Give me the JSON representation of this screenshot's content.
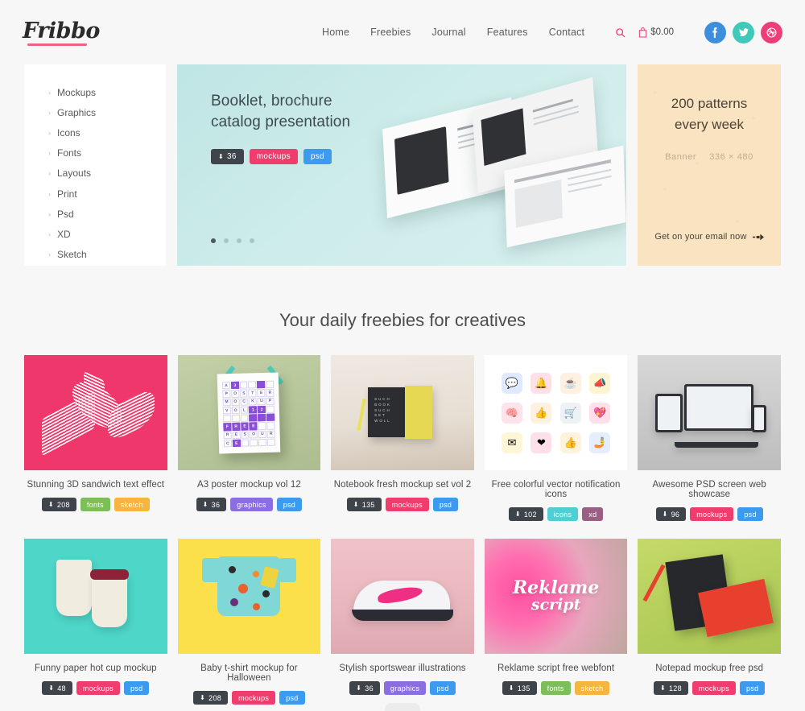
{
  "header": {
    "logo": "Fribbo",
    "nav": [
      {
        "label": "Home"
      },
      {
        "label": "Freebies"
      },
      {
        "label": "Journal"
      },
      {
        "label": "Features"
      },
      {
        "label": "Contact"
      }
    ],
    "search_icon": "search-icon",
    "cart_icon": "cart-icon",
    "cart_total": "$0.00",
    "socials": [
      {
        "name": "facebook",
        "glyph": "f",
        "color": "#3e8ede"
      },
      {
        "name": "twitter",
        "glyph": "t",
        "color": "#3ec9b8"
      },
      {
        "name": "dribbble",
        "glyph": "◎",
        "color": "#ef3d78"
      }
    ]
  },
  "sidebar": {
    "items": [
      {
        "label": "Mockups"
      },
      {
        "label": "Graphics"
      },
      {
        "label": "Icons"
      },
      {
        "label": "Fonts"
      },
      {
        "label": "Layouts"
      },
      {
        "label": "Print"
      },
      {
        "label": "Psd"
      },
      {
        "label": "XD"
      },
      {
        "label": "Sketch"
      }
    ]
  },
  "slider": {
    "title_line1": "Booklet, brochure",
    "title_line2": "catalog presentation",
    "downloads": "36",
    "tags": [
      {
        "label": "mockups",
        "color": "#ef3d6e"
      },
      {
        "label": "psd",
        "color": "#3d9bef"
      }
    ],
    "dots": 4,
    "active_dot": 0
  },
  "promo": {
    "title_line1": "200 patterns",
    "title_line2": "every week",
    "label": "Banner",
    "size": "336 × 480",
    "cta": "Get on your email now",
    "cta_icon": "arrow-right-icon"
  },
  "section": {
    "title": "Your daily freebies for creatives"
  },
  "colors": {
    "tag_mockups": "#ef3d6e",
    "tag_psd": "#3d9bef",
    "tag_fonts": "#7cbf5a",
    "tag_sketch": "#f5b53f",
    "tag_graphics": "#8b6fe0",
    "tag_icons": "#4fcfd4",
    "tag_xd": "#9b5f86",
    "downloads_badge": "#3f444b"
  },
  "cards": [
    {
      "title": "Stunning 3D sandwich text effect",
      "downloads": "208",
      "tags": [
        {
          "label": "fonts",
          "color": "#7cbf5a"
        },
        {
          "label": "sketch",
          "color": "#f5b53f"
        }
      ],
      "thumb": "sandwich-3d-text"
    },
    {
      "title": "A3 poster mockup vol 12",
      "downloads": "36",
      "tags": [
        {
          "label": "graphics",
          "color": "#8b6fe0"
        },
        {
          "label": "psd",
          "color": "#3d9bef"
        }
      ],
      "thumb": "a3-poster-crossword"
    },
    {
      "title": "Notebook fresh mockup set vol 2",
      "downloads": "135",
      "tags": [
        {
          "label": "mockups",
          "color": "#ef3d6e"
        },
        {
          "label": "psd",
          "color": "#3d9bef"
        }
      ],
      "thumb": "notebook-set"
    },
    {
      "title": "Free colorful vector notification icons",
      "downloads": "102",
      "tags": [
        {
          "label": "icons",
          "color": "#4fcfd4"
        },
        {
          "label": "xd",
          "color": "#9b5f86"
        }
      ],
      "thumb": "notification-icons"
    },
    {
      "title": "Awesome PSD screen web showcase",
      "downloads": "96",
      "tags": [
        {
          "label": "mockups",
          "color": "#ef3d6e"
        },
        {
          "label": "psd",
          "color": "#3d9bef"
        }
      ],
      "thumb": "device-screens"
    },
    {
      "title": "Funny paper hot cup mockup",
      "downloads": "48",
      "tags": [
        {
          "label": "mockups",
          "color": "#ef3d6e"
        },
        {
          "label": "psd",
          "color": "#3d9bef"
        }
      ],
      "thumb": "paper-cups"
    },
    {
      "title": "Baby t-shirt mockup for Halloween",
      "downloads": "208",
      "tags": [
        {
          "label": "mockups",
          "color": "#ef3d6e"
        },
        {
          "label": "psd",
          "color": "#3d9bef"
        }
      ],
      "thumb": "baby-tshirt"
    },
    {
      "title": "Stylish sportswear illustrations",
      "downloads": "36",
      "tags": [
        {
          "label": "graphics",
          "color": "#8b6fe0"
        },
        {
          "label": "psd",
          "color": "#3d9bef"
        }
      ],
      "thumb": "sport-shoe"
    },
    {
      "title": "Reklame script free webfont",
      "downloads": "135",
      "tags": [
        {
          "label": "fonts",
          "color": "#7cbf5a"
        },
        {
          "label": "sketch",
          "color": "#f5b53f"
        }
      ],
      "thumb": "reklame-script",
      "thumb_text_line1": "Reklame",
      "thumb_text_line2": "script"
    },
    {
      "title": "Notepad mockup free psd",
      "downloads": "128",
      "tags": [
        {
          "label": "mockups",
          "color": "#ef3d6e"
        },
        {
          "label": "psd",
          "color": "#3d9bef"
        }
      ],
      "thumb": "notepad-red"
    }
  ],
  "poster_grid": [
    [
      "A",
      "3",
      "",
      "",
      "",
      ""
    ],
    [
      "P",
      "O",
      "S",
      "T",
      "E",
      "R"
    ],
    [
      "M",
      "O",
      "C",
      "K",
      "U",
      "P"
    ],
    [
      "V",
      "O",
      "L",
      "1",
      "2",
      ""
    ],
    [
      "",
      "",
      "",
      "",
      "",
      ""
    ],
    [
      "F",
      "R",
      "E",
      "E",
      "",
      ""
    ],
    [
      "R",
      "E",
      "S",
      "O",
      "U",
      "R"
    ],
    [
      "C",
      "E",
      "",
      "",
      "",
      ""
    ]
  ],
  "poster_fills": [
    [
      0,
      1,
      0,
      0,
      1,
      0
    ],
    [
      0,
      0,
      0,
      0,
      0,
      0
    ],
    [
      0,
      0,
      0,
      0,
      0,
      0
    ],
    [
      0,
      0,
      0,
      1,
      1,
      0
    ],
    [
      0,
      0,
      0,
      1,
      1,
      1
    ],
    [
      1,
      1,
      1,
      1,
      0,
      0
    ],
    [
      0,
      0,
      0,
      0,
      0,
      0
    ],
    [
      0,
      1,
      0,
      0,
      0,
      0
    ]
  ],
  "notification_icons": [
    {
      "glyph": "💬",
      "bg": "#dfe9ff"
    },
    {
      "glyph": "🔔",
      "bg": "#ffe0e8"
    },
    {
      "glyph": "☕",
      "bg": "#fff0e2"
    },
    {
      "glyph": "📣",
      "bg": "#fff4d2"
    },
    {
      "glyph": "🧠",
      "bg": "#ffe3ea"
    },
    {
      "glyph": "👍",
      "bg": "#fff1e0"
    },
    {
      "glyph": "🛒",
      "bg": "#eef1f6"
    },
    {
      "glyph": "💖",
      "bg": "#ffe0ea"
    },
    {
      "glyph": "✉",
      "bg": "#fff6d8"
    },
    {
      "glyph": "❤",
      "bg": "#ffdfe9"
    },
    {
      "glyph": "👍",
      "bg": "#fff3de"
    },
    {
      "glyph": "🤳",
      "bg": "#e6edff"
    }
  ]
}
